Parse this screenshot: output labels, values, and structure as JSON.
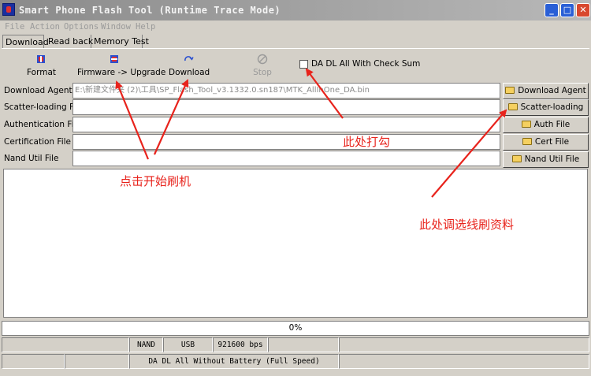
{
  "window": {
    "title": "Smart Phone Flash Tool (Runtime Trace Mode)",
    "min_glyph": "_",
    "max_glyph": "□",
    "close_glyph": "✕"
  },
  "menu": [
    "File",
    "Action",
    "Options",
    "Window",
    "Help"
  ],
  "tabs": [
    "Download",
    "Read back",
    "Memory Test"
  ],
  "toolbar": {
    "format": "Format",
    "firmware_upgrade": "Firmware -> Upgrade",
    "download": "Download",
    "stop": "Stop",
    "checksum_label": "DA DL All With Check Sum"
  },
  "rows": [
    {
      "label": "Download Agent",
      "value": "E:\\新建文件夹 (2)\\工具\\SP_Flash_Tool_v3.1332.0.sn187\\MTK_AllInOne_DA.bin",
      "button": "Download Agent"
    },
    {
      "label": "Scatter-loading File",
      "value": "",
      "button": "Scatter-loading"
    },
    {
      "label": "Authentication File",
      "value": "",
      "button": "Auth File"
    },
    {
      "label": "Certification File",
      "value": "",
      "button": "Cert File"
    },
    {
      "label": "Nand Util File",
      "value": "",
      "button": "Nand Util File"
    }
  ],
  "progress": {
    "text": "0%",
    "value": 0
  },
  "status": {
    "storage": "NAND",
    "connection": "USB",
    "baud": "921600 bps",
    "mode": "DA DL All Without Battery (Full Speed)"
  },
  "annotations": {
    "click_to_flash": "点击开始刷机",
    "check_here": "此处打勾",
    "select_files": "此处调选线刷资料"
  },
  "colors": {
    "annotation": "#e8231c",
    "progress": "#0a246a"
  }
}
